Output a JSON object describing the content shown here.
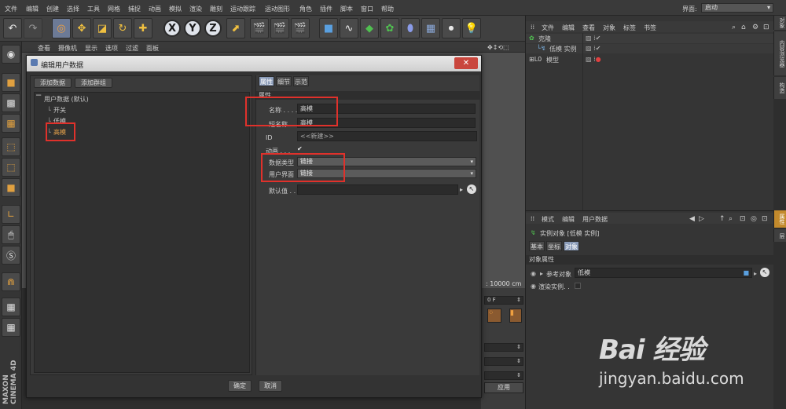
{
  "menubar": {
    "items": [
      "文件",
      "编辑",
      "创建",
      "选择",
      "工具",
      "网格",
      "捕捉",
      "动画",
      "模拟",
      "渲染",
      "雕刻",
      "运动跟踪",
      "运动图形",
      "角色",
      "插件",
      "脚本",
      "窗口",
      "帮助"
    ],
    "layout_label": "界面:",
    "layout_value": "启动"
  },
  "viewport_menu": [
    "查看",
    "摄像机",
    "显示",
    "选项",
    "过滤",
    "面板"
  ],
  "viewport_info": ": 10000 cm",
  "timeline": {
    "frame": "0 F"
  },
  "dialog": {
    "title": "编辑用户数据",
    "close": "✕",
    "add_data": "添加数据",
    "add_group": "添加群组",
    "tree_root": "用户数据 (默认)",
    "tree_children": [
      "开关",
      "低模",
      "高模"
    ],
    "tabs": [
      "属性",
      "细节",
      "示范"
    ],
    "section": "属性",
    "props": {
      "name_label": "名称 . . . .",
      "name_value": "高模",
      "short_label": "短名称 . .",
      "short_value": "高模",
      "id_label": "ID",
      "id_value": "<<新建>>",
      "anim_label": "动画 . . .",
      "anim_value": "✔",
      "dtype_label": "数据类型",
      "dtype_value": "链接",
      "ui_label": "用户界面",
      "ui_value": "链接",
      "default_label": "默认值 . ."
    },
    "ok": "确定",
    "cancel": "取消"
  },
  "object_manager": {
    "menu": [
      "文件",
      "编辑",
      "查看",
      "对象",
      "标签",
      "书签"
    ],
    "objects": [
      {
        "name": "克隆",
        "color": "#e8a24a"
      },
      {
        "name": "低模 实例",
        "color": "#e8a24a"
      },
      {
        "name": "模型",
        "color": "#cfcfcf"
      }
    ]
  },
  "attribute_manager": {
    "menu": [
      "模式",
      "编辑",
      "用户数据"
    ],
    "object_title": "实例对象 [低模 实例]",
    "tabs": [
      "基本",
      "坐标",
      "对象"
    ],
    "section": "对象属性",
    "ref_label": "参考对象",
    "ref_value": "低模",
    "render_label": "渲染实例. ."
  },
  "right_sidetabs": [
    "对象",
    "内容浏览器",
    "构造"
  ],
  "attr_sidetabs": [
    "属性",
    "层"
  ],
  "apply_button": "应用",
  "watermark": {
    "logo": "Bai 经验",
    "url": "jingyan.baidu.com"
  },
  "brand": "MAXON CINEMA 4D"
}
